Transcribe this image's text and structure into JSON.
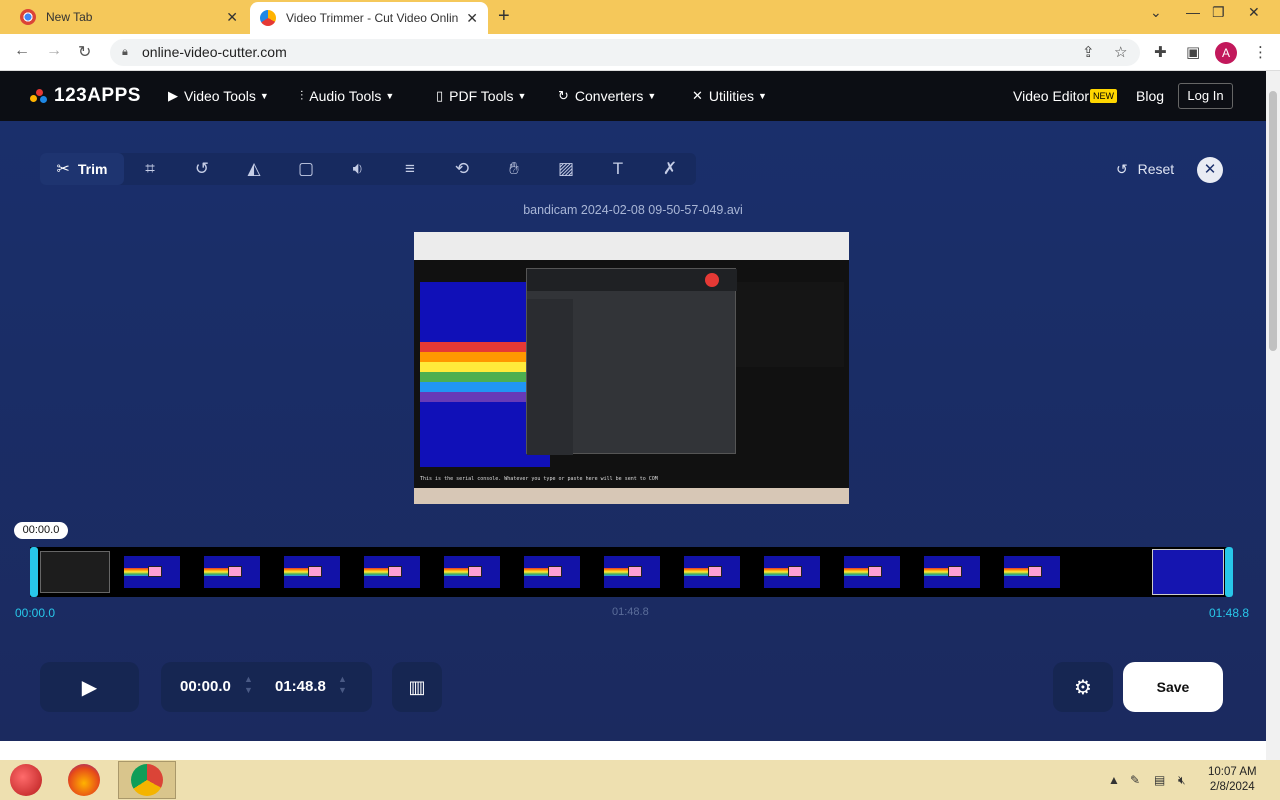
{
  "browser": {
    "tabs": [
      {
        "title": "New Tab",
        "icon": "chrome-icon"
      },
      {
        "title": "Video Trimmer - Cut Video Onlin",
        "icon": "123apps-icon"
      }
    ],
    "url": "online-video-cutter.com",
    "profile_initial": "A"
  },
  "site": {
    "logo": "123APPS",
    "nav": [
      {
        "label": "Video Tools",
        "icon": "play-square-icon"
      },
      {
        "label": "Audio Tools",
        "icon": "waveform-icon"
      },
      {
        "label": "PDF Tools",
        "icon": "document-icon"
      },
      {
        "label": "Converters",
        "icon": "convert-icon"
      },
      {
        "label": "Utilities",
        "icon": "tools-icon"
      }
    ],
    "video_editor": "Video Editor",
    "new_badge": "NEW",
    "blog": "Blog",
    "login": "Log In"
  },
  "editor": {
    "toolbar": {
      "trim": "Trim",
      "tools": [
        "crop-icon",
        "rotate-icon",
        "flip-icon",
        "resize-icon",
        "volume-icon",
        "speed-icon",
        "loop-icon",
        "stabilize-icon",
        "image-icon",
        "text-icon",
        "remove-logo-icon"
      ]
    },
    "reset": "Reset",
    "filename": "bandicam 2024-02-08 09-50-57-049.avi",
    "preview_caption": "This is the serial console. Whatever you type or paste here will be sent to COM"
  },
  "timeline": {
    "cursor_time": "00:00.0",
    "start_label": "00:00.0",
    "mid_label": "01:48.8",
    "end_label": "01:48.8",
    "frame_count": 14
  },
  "controls": {
    "start_time": "00:00.0",
    "end_time": "01:48.8",
    "save": "Save"
  },
  "taskbar": {
    "time": "10:07 AM",
    "date": "2/8/2024"
  },
  "colors": {
    "accent": "#28c7e9",
    "editor_bg": "#1a2f6b",
    "badge": "#ffd600"
  }
}
